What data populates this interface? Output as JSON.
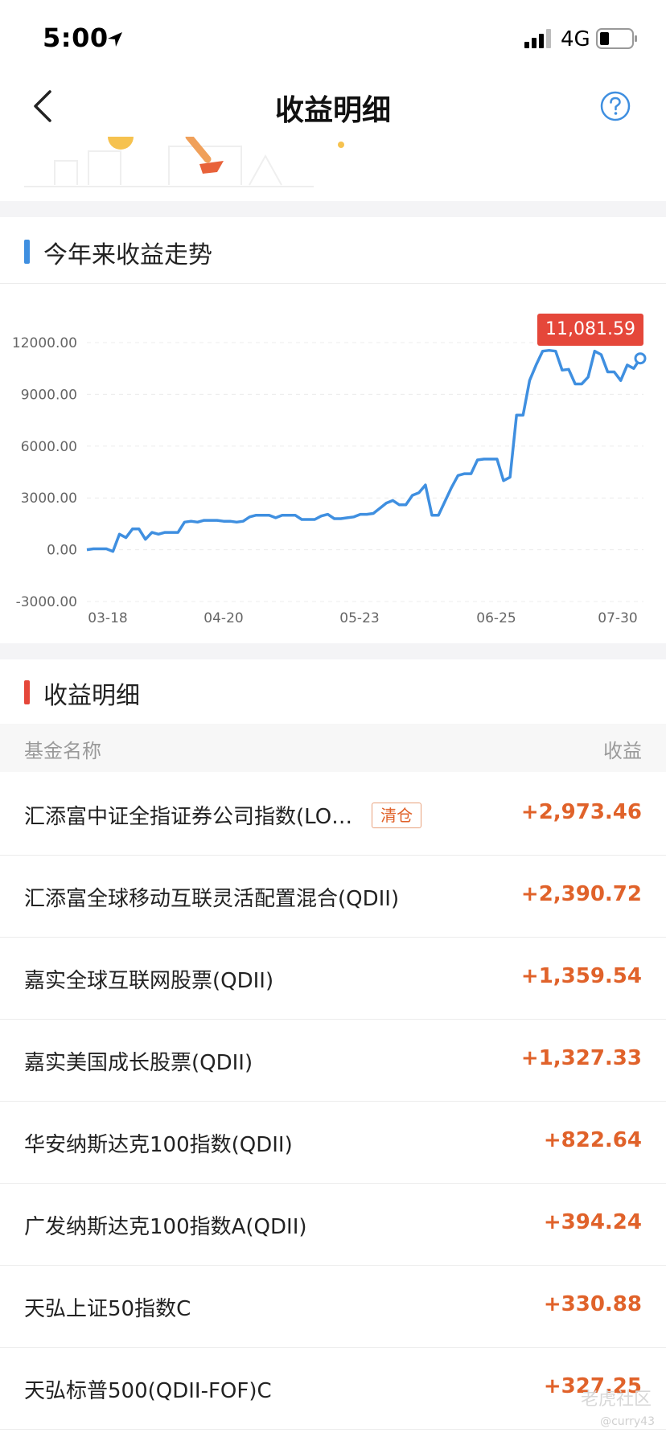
{
  "status_bar": {
    "time": "5:00",
    "network": "4G"
  },
  "nav": {
    "title": "收益明细"
  },
  "trend_section": {
    "title": "今年来收益走势"
  },
  "chart_data": {
    "type": "line",
    "title": "今年来收益走势",
    "xlabel": "",
    "ylabel": "",
    "ylim": [
      -3000,
      12000
    ],
    "y_ticks": [
      "12000.00",
      "9000.00",
      "6000.00",
      "3000.00",
      "0.00",
      "-3000.00"
    ],
    "x_ticks": [
      "03-18",
      "04-20",
      "05-23",
      "06-25",
      "07-30"
    ],
    "grid": true,
    "peak_label": "11,081.59",
    "series": [
      {
        "values": [
          0,
          50,
          50,
          50,
          -100,
          900,
          700,
          1200,
          1200,
          600,
          1000,
          900,
          1000,
          1000,
          1000,
          1600,
          1650,
          1600,
          1700,
          1700,
          1700,
          1650,
          1650,
          1600,
          1650,
          1900,
          2000,
          2000,
          2000,
          1850,
          2000,
          2000,
          2000,
          1750,
          1750,
          1750,
          1950,
          2050,
          1800,
          1800,
          1850,
          1900,
          2050,
          2050,
          2100,
          2400,
          2700,
          2850,
          2600,
          2600,
          3150,
          3300,
          3750,
          2000,
          2000,
          2800,
          3600,
          4300,
          4400,
          4400,
          5200,
          5250,
          5250,
          5250,
          4000,
          4200,
          7800,
          7800,
          9800,
          10700,
          11500,
          11550,
          11500,
          10400,
          10450,
          9600,
          9600,
          10000,
          11500,
          11300,
          10300,
          10300,
          9800,
          10700,
          10500,
          11081.59
        ],
        "color": "#3f8fe0"
      }
    ]
  },
  "detail_section": {
    "title": "收益明细"
  },
  "table": {
    "col_name": "基金名称",
    "col_value": "收益",
    "tag_clear": "清仓",
    "rows": [
      {
        "name": "汇添富中证全指证券公司指数(LO…",
        "value": "+2,973.46"
      },
      {
        "name": "汇添富全球移动互联灵活配置混合(QDII)",
        "value": "+2,390.72"
      },
      {
        "name": "嘉实全球互联网股票(QDII)",
        "value": "+1,359.54"
      },
      {
        "name": "嘉实美国成长股票(QDII)",
        "value": "+1,327.33"
      },
      {
        "name": "华安纳斯达克100指数(QDII)",
        "value": "+822.64"
      },
      {
        "name": "广发纳斯达克100指数A(QDII)",
        "value": "+394.24"
      },
      {
        "name": "天弘上证50指数C",
        "value": "+330.88"
      },
      {
        "name": "天弘标普500(QDII-FOF)C",
        "value": "+327.25"
      }
    ]
  },
  "watermark": {
    "brand": "老虎社区",
    "user": "@curry43"
  },
  "colors": {
    "accent_blue": "#3f8fe0",
    "gain": "#e0622a",
    "badge_red": "#e5473a",
    "section_red": "#e5473a"
  }
}
